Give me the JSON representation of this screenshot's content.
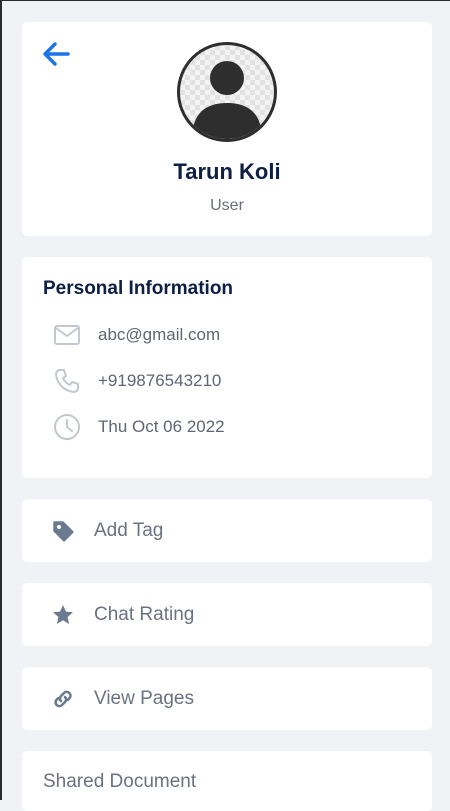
{
  "profile": {
    "name": "Tarun Koli",
    "role": "User"
  },
  "personal_info": {
    "title": "Personal Information",
    "email": "abc@gmail.com",
    "phone": "+919876543210",
    "date": "Thu Oct 06 2022"
  },
  "actions": {
    "add_tag": "Add Tag",
    "chat_rating": "Chat Rating",
    "view_pages": "View Pages",
    "shared_document": "Shared Document"
  },
  "icons": {
    "back": "arrow-left-icon",
    "avatar": "user-avatar-icon",
    "email": "mail-icon",
    "phone": "phone-icon",
    "date": "clock-icon",
    "tag": "tag-icon",
    "rating": "star-icon",
    "pages": "link-icon"
  },
  "colors": {
    "accent": "#1a73e8",
    "heading": "#0d1f45",
    "muted_text": "#6b7280",
    "icon_gray": "#6b7a90",
    "background": "#f1f2f5"
  }
}
